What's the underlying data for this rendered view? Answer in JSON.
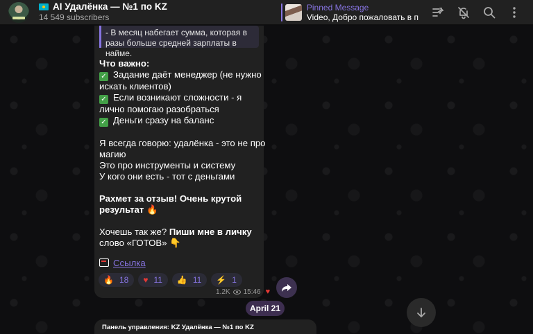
{
  "header": {
    "title": "AI Удалёнка — №1 по KZ",
    "subscribers": "14 549 subscribers",
    "pinned": {
      "title": "Pinned Message",
      "text": "Video, Добро пожаловать в п..."
    },
    "icons": [
      "pinned-list-icon",
      "mute-icon",
      "search-icon",
      "more-icon"
    ]
  },
  "message": {
    "quote": "- В месяц набегает сумма, которая в разы больше средней зарплаты в найме.",
    "important_heading": "Что важно:",
    "checklist": [
      "Задание даёт менеджер (не нужно искать клиентов)",
      "Если возникают сложности - я лично помогаю разобраться",
      "Деньги сразу на баланс"
    ],
    "para_lines": [
      "Я всегда говорю: удалёнка - это не про магию",
      "Это про инструменты и систему",
      "У кого они есть - тот с деньгами"
    ],
    "thanks": "Рахмет за отзыв! Очень крутой результат",
    "thanks_emoji": "🔥",
    "cta_prefix": "Хочешь так же?",
    "cta_bold": "Пиши мне в личку",
    "cta_rest": "слово «ГОТОВ»",
    "cta_emoji": "👇",
    "link_label": "Ссылка"
  },
  "reactions": [
    {
      "emoji": "🔥",
      "count": "18"
    },
    {
      "emoji": "♥",
      "count": "11"
    },
    {
      "emoji": "👍",
      "count": "11"
    },
    {
      "emoji": "⚡",
      "count": "1"
    }
  ],
  "meta": {
    "views": "1.2K",
    "time": "15:46",
    "reaction_mini": "♥"
  },
  "date_divider": "April 21",
  "next_message_preview": "Панель управления: KZ Удалёнка — №1 по KZ",
  "colors": {
    "accent": "#8774e1",
    "bubble": "#212121",
    "header": "#212121"
  }
}
